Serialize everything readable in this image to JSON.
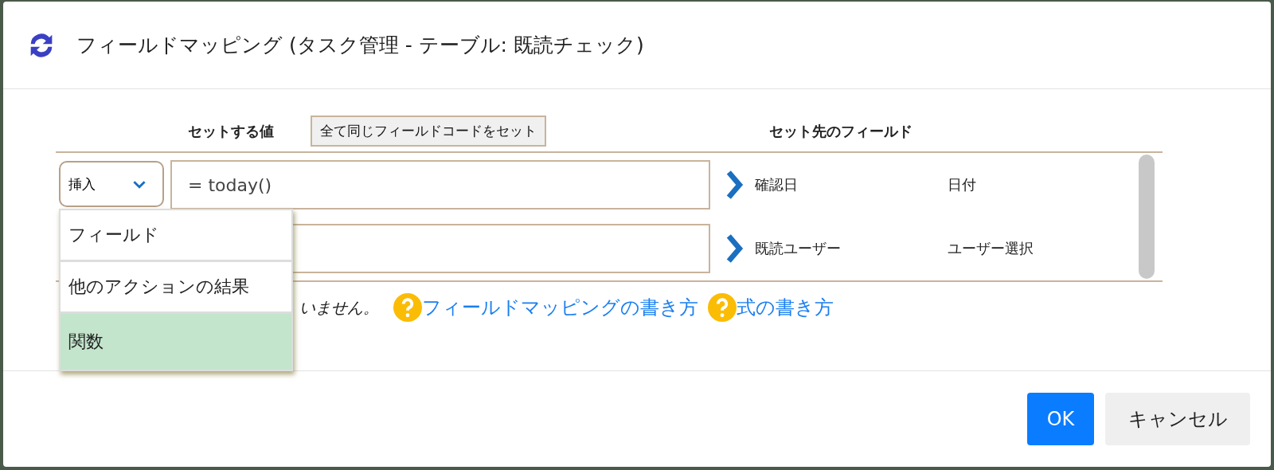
{
  "dialog": {
    "title": "フィールドマッピング (タスク管理 - テーブル: 既読チェック)",
    "header": {
      "value_column": "セットする値",
      "set_all_button": "全て同じフィールドコードをセット",
      "target_column": "セット先のフィールド"
    },
    "rows": [
      {
        "insert_menu": {
          "label": "挿入",
          "expanded": true,
          "options": [
            {
              "label": "フィールド",
              "selected": false
            },
            {
              "label": "他のアクションの結果",
              "selected": false
            },
            {
              "label": "関数",
              "selected": true
            }
          ]
        },
        "value": "= today()",
        "target_field": "確認日",
        "field_type": "日付"
      },
      {
        "target_field": "既読ユーザー",
        "field_type": "ユーザー選択"
      }
    ],
    "hint": "いません。",
    "help_links": [
      {
        "label": "フィールドマッピングの書き方"
      },
      {
        "label": "式の書き方"
      }
    ],
    "buttons": [
      {
        "label": "OK",
        "kind": "primary"
      },
      {
        "label": "キャンセル",
        "kind": "secondary"
      }
    ]
  }
}
